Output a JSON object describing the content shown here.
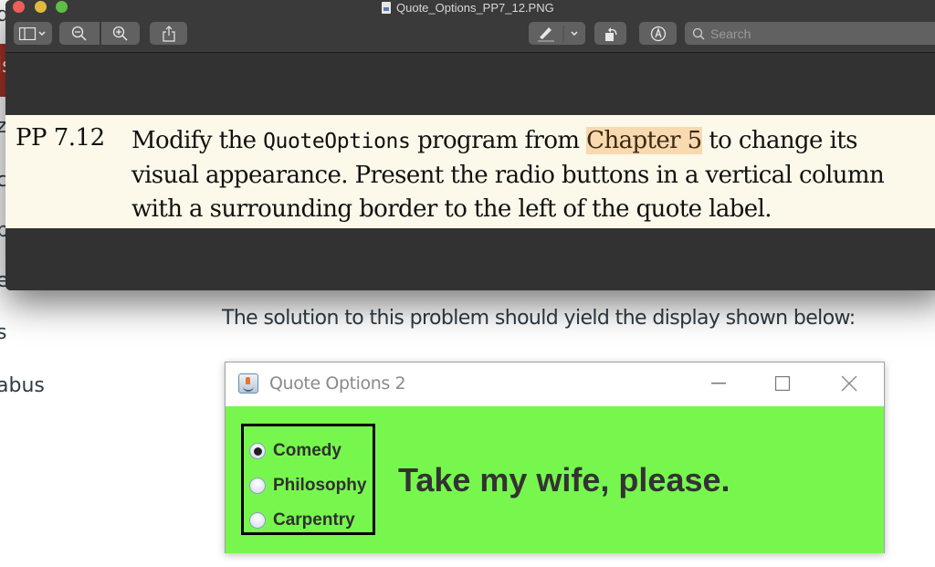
{
  "background_page": {
    "sidebar_fragments": [
      "d",
      "is",
      "z",
      "c",
      "p",
      "e",
      "s",
      "abus"
    ],
    "instruction_text": "The solution to this problem should yield  the display shown below:"
  },
  "preview_window": {
    "title": "Quote_Options_PP7_12.PNG",
    "toolbar": {
      "sidebar_toggle_icon": "sidebar-icon",
      "zoom_out_icon": "zoom-out-icon",
      "zoom_in_icon": "zoom-in-icon",
      "share_icon": "share-icon",
      "markup_icon": "pen-icon",
      "rotate_icon": "rotate-icon",
      "annotate_icon": "markup-circle-icon",
      "search_placeholder": "Search",
      "search_value": ""
    },
    "document": {
      "problem_number": "PP 7.12",
      "line1_before": "Modify the ",
      "line1_code": "QuoteOptions",
      "line1_middle": " program from ",
      "line1_highlight": "Chapter 5",
      "line1_after": " to change its",
      "line2": "visual appearance. Present the radio buttons in a vertical column",
      "line3": "with a surrounding border to the left of the quote label."
    }
  },
  "java_window": {
    "title": "Quote Options 2",
    "controls": [
      "minimize",
      "maximize",
      "close"
    ],
    "background_color": "#77f74e",
    "radio_options": [
      {
        "label": "Comedy",
        "selected": true
      },
      {
        "label": "Philosophy",
        "selected": false
      },
      {
        "label": "Carpentry",
        "selected": false
      }
    ],
    "quote": "Take my wife, please."
  }
}
